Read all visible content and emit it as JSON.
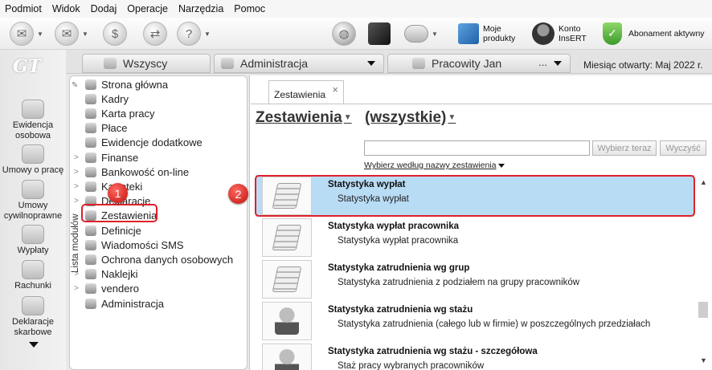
{
  "menu": [
    "Podmiot",
    "Widok",
    "Dodaj",
    "Operacje",
    "Narzędzia",
    "Pomoc"
  ],
  "toolbar": {
    "moje_produkty": [
      "Moje",
      "produkty"
    ],
    "konto": [
      "Konto",
      "InsERT"
    ],
    "abonament": "Abonament aktywny"
  },
  "logo": "GT",
  "leftnav": [
    [
      "Ewidencja",
      "osobowa"
    ],
    [
      "Umowy o pracę"
    ],
    [
      "Umowy",
      "cywilnoprawne"
    ],
    [
      "Wypłaty"
    ],
    [
      "Rachunki"
    ],
    [
      "Deklaracje",
      "skarbowe"
    ]
  ],
  "tabs": {
    "wszyscy": "Wszyscy",
    "administracja": "Administracja",
    "pracownik": "Pracowity Jan",
    "more": "...",
    "miesiac": "Miesiąc otwarty:  Maj 2022 r."
  },
  "modules": {
    "side_label": "Lista modułów",
    "items": [
      {
        "label": "Strona główna",
        "exp": ""
      },
      {
        "label": "Kadry",
        "exp": ""
      },
      {
        "label": "Karta pracy",
        "exp": ""
      },
      {
        "label": "Płace",
        "exp": ""
      },
      {
        "label": "Ewidencje dodatkowe",
        "exp": ""
      },
      {
        "label": "Finanse",
        "exp": ">"
      },
      {
        "label": "Bankowość on-line",
        "exp": ">"
      },
      {
        "label": "Kartoteki",
        "exp": ">"
      },
      {
        "label": "Deklaracje",
        "exp": ">"
      },
      {
        "label": "Zestawienia",
        "exp": ""
      },
      {
        "label": "Definicje",
        "exp": ""
      },
      {
        "label": "Wiadomości SMS",
        "exp": ""
      },
      {
        "label": "Ochrona danych osobowych",
        "exp": ">"
      },
      {
        "label": "Naklejki",
        "exp": ">"
      },
      {
        "label": "vendero",
        "exp": ">"
      },
      {
        "label": "Administracja",
        "exp": ""
      }
    ]
  },
  "badges": {
    "one": "1",
    "two": "2"
  },
  "content": {
    "tab_label": "Zestawienia",
    "tab_close": "×",
    "heading": "Zestawienia",
    "heading_filter": "(wszystkie)",
    "search_value": "",
    "choose_button": "Wybierz teraz",
    "search_button": "Wyczyść",
    "filter_link": "Wybierz według nazwy zestawienia",
    "rows": [
      {
        "title": "Statystyka wypłat",
        "desc": "Statystyka wypłat",
        "selected": true,
        "icon": "paper-stack-icon"
      },
      {
        "title": "Statystyka wypłat pracownika",
        "desc": "Statystyka wypłat pracownika",
        "selected": false,
        "icon": "paper-stack-icon"
      },
      {
        "title": "Statystyka zatrudnienia wg grup",
        "desc": "Statystyka zatrudnienia z podziałem na grupy pracowników",
        "selected": false,
        "icon": "sql-report-icon"
      },
      {
        "title": "Statystyka zatrudnienia wg stażu",
        "desc": "Statystyka zatrudnienia (całego lub w firmie) w poszczególnych przedziałach",
        "selected": false,
        "icon": "person-icon"
      },
      {
        "title": "Statystyka zatrudnienia wg stażu - szczegółowa",
        "desc": "Staż pracy wybranych pracowników",
        "selected": false,
        "icon": "person-icon"
      }
    ]
  },
  "colors": {
    "highlight": "#e0202a",
    "selection": "#b9dcf5"
  }
}
